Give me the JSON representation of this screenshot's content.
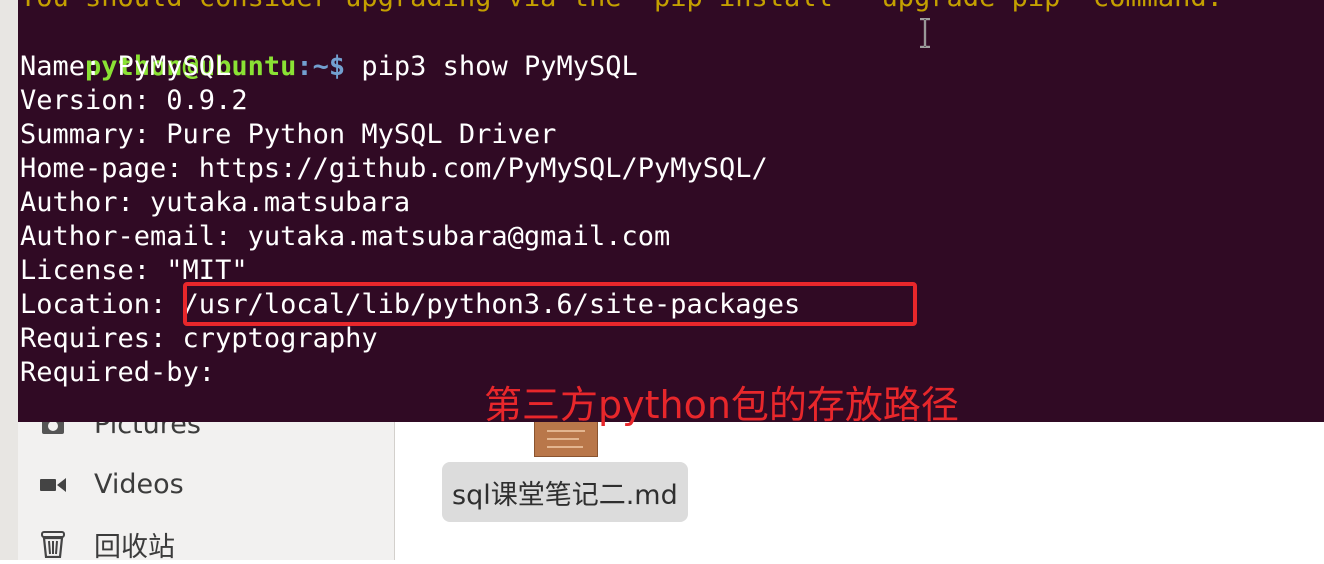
{
  "terminal": {
    "cut_line": "You should consider upgrading via the 'pip install --upgrade pip' command.",
    "prompt_user": "python@ubuntu",
    "prompt_path": ":~$",
    "command": " pip3 show PyMySQL",
    "output": [
      "Name: PyMySQL",
      "Version: 0.9.2",
      "Summary: Pure Python MySQL Driver",
      "Home-page: https://github.com/PyMySQL/PyMySQL/",
      "Author: yutaka.matsubara",
      "Author-email: yutaka.matsubara@gmail.com",
      "License: \"MIT\"",
      "Location: /usr/local/lib/python3.6/site-packages",
      "Requires: cryptography",
      "Required-by:"
    ],
    "colors": {
      "background": "#300a24",
      "user": "#8ae234",
      "path": "#729fcf",
      "text": "#ffffff"
    }
  },
  "annotation": {
    "text": "第三方python包的存放路径",
    "color": "#e8272b"
  },
  "file_manager": {
    "sidebar": [
      {
        "label": "Pictures",
        "icon": "camera-icon"
      },
      {
        "label": "Videos",
        "icon": "video-icon"
      },
      {
        "label": "回收站",
        "icon": "trash-icon"
      }
    ],
    "file": {
      "label": "sql课堂笔记二.md",
      "icon": "markdown-file-icon"
    }
  }
}
